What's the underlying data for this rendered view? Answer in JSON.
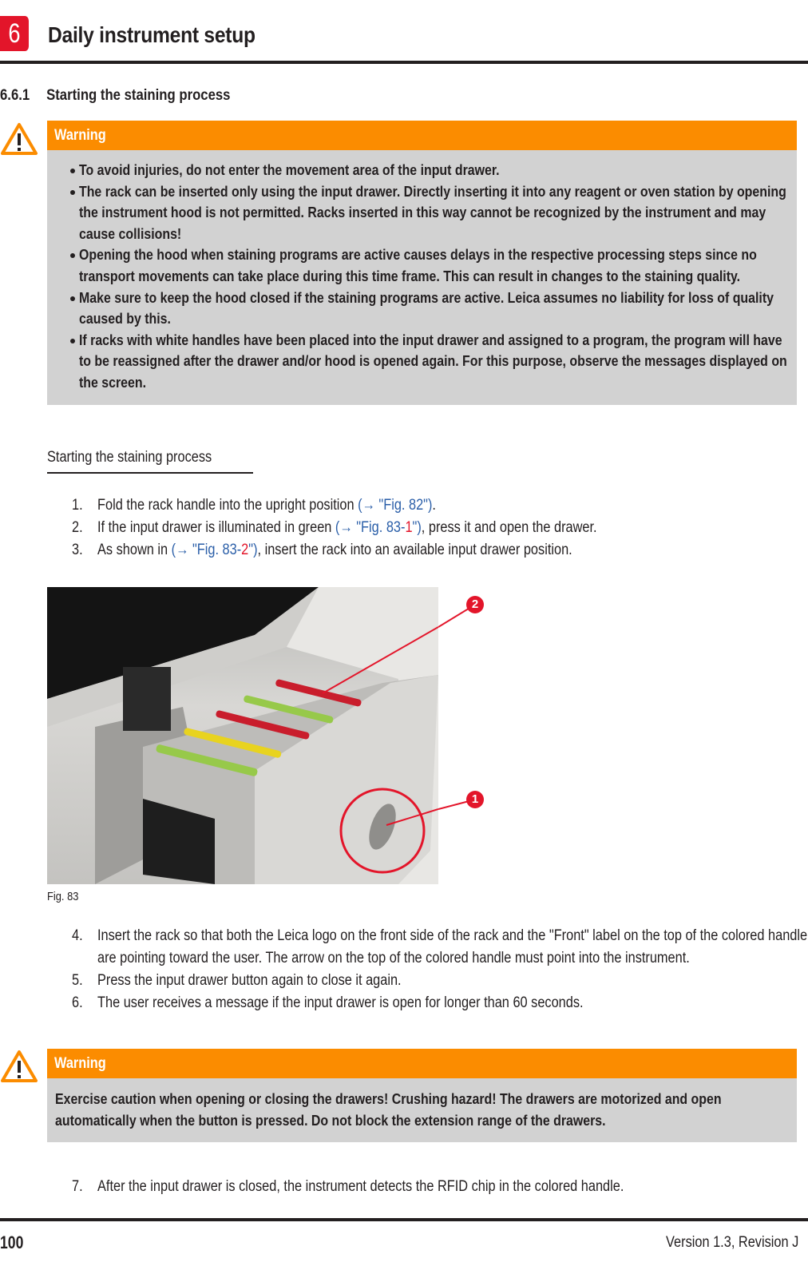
{
  "header": {
    "chapter_number": "6",
    "chapter_title": "Daily instrument setup"
  },
  "section": {
    "number": "6.6.1",
    "title": "Starting the staining process"
  },
  "warning1": {
    "label": "Warning",
    "icon": "warning-triangle-icon",
    "items": [
      "To avoid injuries, do not enter the movement area of the input drawer.",
      "The rack can be inserted only using the input drawer. Directly inserting it into any reagent or oven station by opening the instrument hood is not permitted. Racks inserted in this way cannot be recognized by the instrument and may cause collisions!",
      "Opening the hood when staining programs are active causes delays in the respective processing steps since no transport movements can take place during this time frame. This can result in changes to the staining quality.",
      "Make sure to keep the hood closed if the staining programs are active. Leica assumes no liability for loss of quality caused by this.",
      "If racks with white handles have been placed into the input drawer and assigned to a program, the program will have to be reassigned after the drawer and/or hood is opened again. For this purpose, observe the messages displayed on the screen."
    ]
  },
  "subheading": "Starting the staining process",
  "steps_a": [
    {
      "n": "1.",
      "before": "Fold the rack handle into the upright position ",
      "ref": "(→ \"Fig. 82\")",
      "ref_red": "",
      "ref_end": "",
      "after": "."
    },
    {
      "n": "2.",
      "before": "If the input drawer is illuminated in green ",
      "ref": "(→ \"Fig. 83-",
      "ref_red": "1",
      "ref_end": "\")",
      "after": ", press it and open the drawer."
    },
    {
      "n": "3.",
      "before": "As shown in ",
      "ref": "(→ \"Fig. 83-",
      "ref_red": "2",
      "ref_end": "\")",
      "after": ", insert the rack into an available input drawer position."
    }
  ],
  "figure": {
    "caption": "Fig. 83",
    "callouts": [
      "1",
      "2"
    ],
    "description": "Open input drawer with racks with green, yellow and red handles; drawer button circled"
  },
  "steps_b": [
    {
      "n": "4.",
      "text": "Insert the rack so that both the Leica logo on the front side of the rack and the \"Front\" label on the top of the colored handle are pointing toward the user. The arrow on the top of the colored handle must point into the instrument."
    },
    {
      "n": "5.",
      "text": "Press the input drawer button again to close it again."
    },
    {
      "n": "6.",
      "text": "The user receives a message if the input drawer is open for longer than 60 seconds."
    }
  ],
  "warning2": {
    "label": "Warning",
    "icon": "warning-triangle-icon",
    "text": "Exercise caution when opening or closing the drawers! Crushing hazard! The drawers are motorized and open automatically when the button is pressed. Do not block the extension range of the drawers."
  },
  "steps_c": [
    {
      "n": "7.",
      "text": "After the input drawer is closed, the instrument detects the RFID chip in the colored handle."
    }
  ],
  "footer": {
    "page_number": "100",
    "version": "Version 1.3, Revision J"
  },
  "colors": {
    "brand_red": "#e3152a",
    "warning_orange": "#fb8c00",
    "warning_body": "#d2d2d2",
    "link_blue": "#2a5ea8"
  }
}
